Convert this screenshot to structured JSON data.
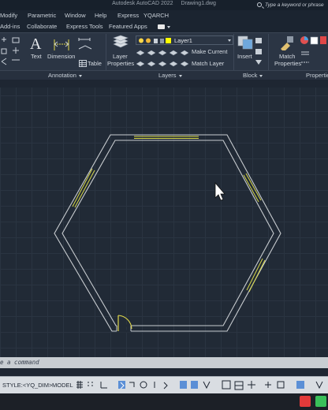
{
  "titlebar": {
    "app_name": "Autodesk AutoCAD 2022",
    "document": "Drawing1.dwg",
    "search_placeholder": "Type a keyword or phrase"
  },
  "menubar": {
    "items": [
      "Modify",
      "Parametric",
      "Window",
      "Help",
      "Express",
      "YQARCH"
    ]
  },
  "ribbon_tabs": {
    "items": [
      "Add-ins",
      "Collaborate",
      "Express Tools",
      "Featured Apps"
    ]
  },
  "ribbon": {
    "annotation": {
      "text_label": "Text",
      "dimension_label": "Dimension",
      "table_label": "Table",
      "panel_title": "Annotation"
    },
    "layers": {
      "layer_properties_line1": "Layer",
      "layer_properties_line2": "Properties",
      "current_layer": "Layer1",
      "current_layer_color": "#ffff00",
      "make_current_label": "Make Current",
      "match_layer_label": "Match Layer",
      "panel_title": "Layers"
    },
    "block": {
      "insert_label": "Insert",
      "panel_title": "Block"
    },
    "properties": {
      "match_properties_line1": "Match",
      "match_properties_line2": "Properties",
      "panel_title": "Properties"
    }
  },
  "command_line": {
    "prompt": "e a command"
  },
  "statusbar": {
    "style_label": "STYLE:<YQ_DIM>",
    "model_label": "MODEL"
  },
  "colors": {
    "wall_line": "#c8ccd0",
    "window_line": "#d9d94a",
    "door_line": "#e0d84a",
    "canvas_bg": "#212a36",
    "ribbon_bg": "#2b3544"
  }
}
